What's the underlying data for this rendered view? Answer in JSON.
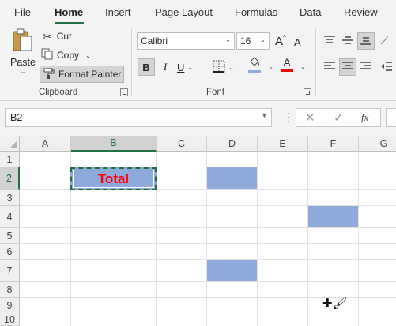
{
  "menu": {
    "tabs": [
      {
        "label": "File"
      },
      {
        "label": "Home"
      },
      {
        "label": "Insert"
      },
      {
        "label": "Page Layout"
      },
      {
        "label": "Formulas"
      },
      {
        "label": "Data"
      },
      {
        "label": "Review"
      }
    ],
    "active_tab": "Home"
  },
  "ribbon": {
    "clipboard": {
      "group_label": "Clipboard",
      "paste_label": "Paste",
      "cut_label": "Cut",
      "copy_label": "Copy",
      "format_painter_label": "Format Painter"
    },
    "font": {
      "group_label": "Font",
      "font_name": "Calibri",
      "font_size": "16",
      "grow_label": "A",
      "shrink_label": "A",
      "bold_label": "B",
      "italic_label": "I",
      "underline_label": "U",
      "font_color_label": "A",
      "fill_color": "#ffff00",
      "font_color": "#ff0000"
    }
  },
  "formula_bar": {
    "name_box": "B2",
    "fx_label": "fx",
    "formula": ""
  },
  "sheet": {
    "columns": [
      "A",
      "B",
      "C",
      "D",
      "E",
      "F",
      "G"
    ],
    "rows": [
      "1",
      "2",
      "3",
      "4",
      "5",
      "6",
      "7",
      "8",
      "9",
      "10"
    ],
    "selected_column": "B",
    "selected_row": "2",
    "active_cell_value": "Total",
    "fill_color": "#8eaadb",
    "text_color": "#ff0000"
  }
}
